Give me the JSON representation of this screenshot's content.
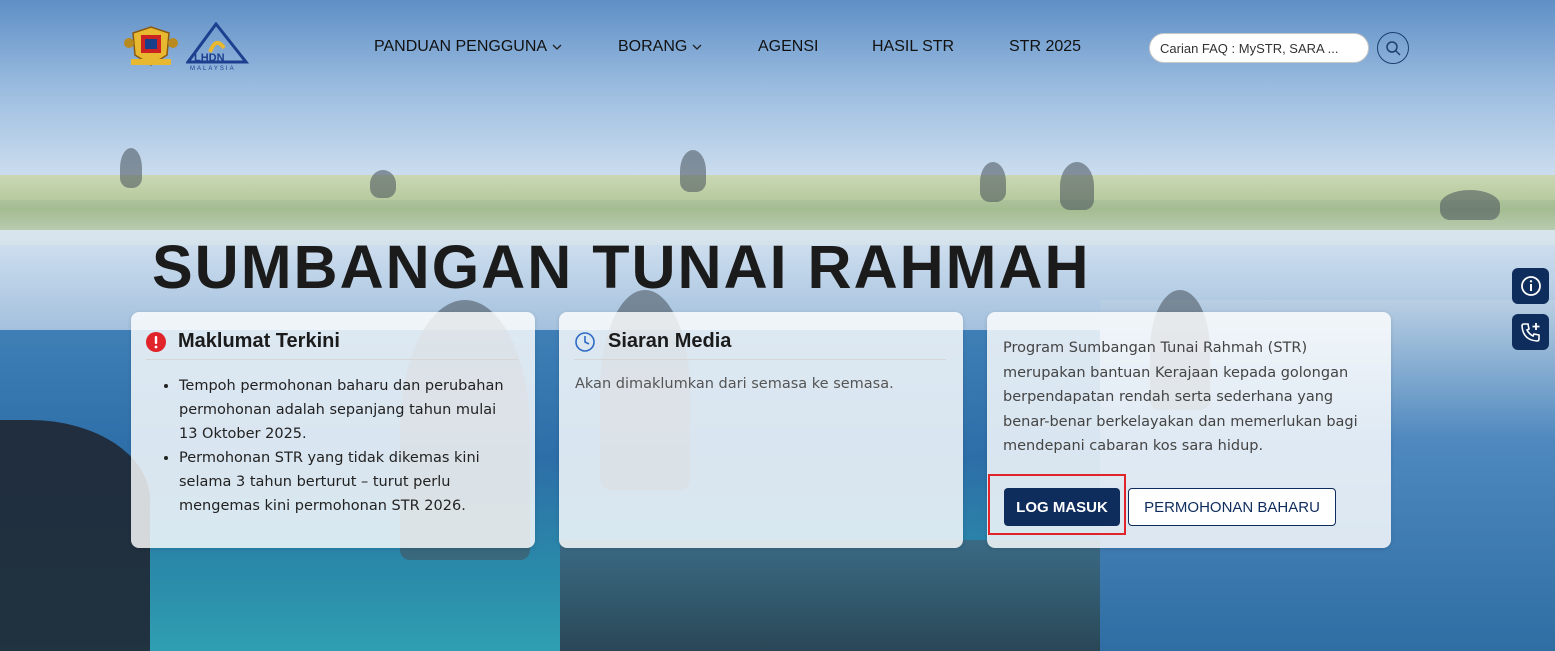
{
  "header": {
    "logos": {
      "crest_icon": "malaysia-crest-icon",
      "lhdn_icon": "lhdn-logo-icon",
      "lhdn_text": "LHDN",
      "lhdn_sub": "MALAYSIA"
    },
    "nav": [
      {
        "label": "PANDUAN PENGGUNA",
        "has_dropdown": true
      },
      {
        "label": "BORANG",
        "has_dropdown": true
      },
      {
        "label": "AGENSI",
        "has_dropdown": false
      },
      {
        "label": "HASIL STR",
        "has_dropdown": false
      },
      {
        "label": "STR 2025",
        "has_dropdown": false
      }
    ],
    "search": {
      "placeholder": "Carian FAQ : MySTR, SARA ...",
      "icon": "search-icon"
    }
  },
  "hero": {
    "title": "SUMBANGAN TUNAI RAHMAH"
  },
  "cards": {
    "latest": {
      "title": "Maklumat Terkini",
      "icon": "alert-icon",
      "items": [
        "Tempoh permohonan baharu dan perubahan permohonan adalah sepanjang tahun mulai 13 Oktober 2025.",
        "Permohonan STR yang tidak dikemas kini selama 3 tahun berturut – turut perlu mengemas kini permohonan STR 2026."
      ]
    },
    "media": {
      "title": "Siaran Media",
      "icon": "clock-icon",
      "text": "Akan dimaklumkan dari semasa ke semasa."
    },
    "program": {
      "description": "Program Sumbangan Tunai Rahmah (STR) merupakan bantuan Kerajaan kepada golongan berpendapatan rendah serta sederhana yang benar-benar berkelayakan dan memerlukan bagi mendepani cabaran kos sara hidup.",
      "login_label": "LOG MASUK",
      "new_application_label": "PERMOHONAN BAHARU"
    }
  },
  "floating": {
    "info_icon": "info-icon",
    "call_icon": "phone-add-icon"
  },
  "colors": {
    "primary": "#0f2d5c",
    "highlight": "#e0242a",
    "alert": "#e0242a",
    "clock": "#2f6bc4"
  }
}
